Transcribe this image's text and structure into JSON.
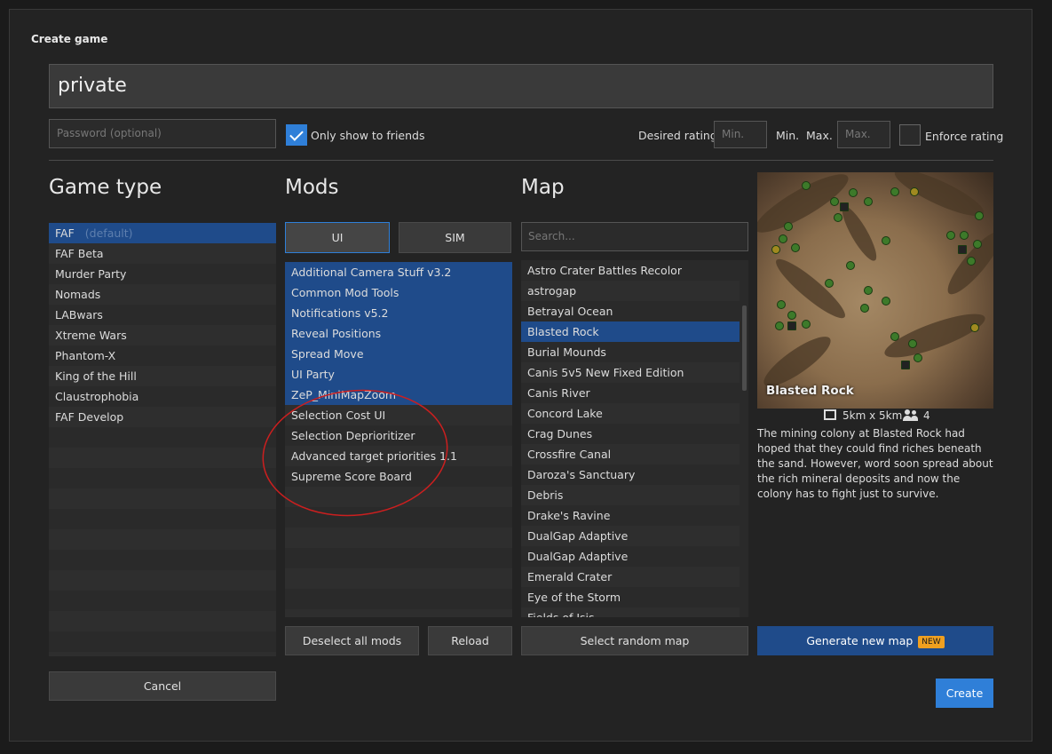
{
  "dialog": {
    "title": "Create game"
  },
  "game_name": {
    "value": "private"
  },
  "password": {
    "placeholder": "Password (optional)"
  },
  "friends_only": {
    "label": "Only show to friends",
    "checked": true
  },
  "rating": {
    "desired_label": "Desired rating",
    "min_placeholder": "Min.",
    "min_label": "Min.",
    "max_label": "Max.",
    "max_placeholder": "Max.",
    "enforce_label": "Enforce rating",
    "enforce_checked": false
  },
  "game_type": {
    "heading": "Game type",
    "items": [
      {
        "label": "FAF",
        "note": "(default)",
        "selected": true
      },
      {
        "label": "FAF Beta"
      },
      {
        "label": "Murder Party"
      },
      {
        "label": "Nomads"
      },
      {
        "label": "LABwars"
      },
      {
        "label": "Xtreme Wars"
      },
      {
        "label": "Phantom-X"
      },
      {
        "label": "King of the Hill"
      },
      {
        "label": "Claustrophobia"
      },
      {
        "label": "FAF Develop"
      }
    ]
  },
  "mods": {
    "heading": "Mods",
    "tab_ui": "UI",
    "tab_sim": "SIM",
    "items": [
      {
        "label": "Additional Camera Stuff v3.2",
        "selected": true
      },
      {
        "label": "Common Mod Tools",
        "selected": true
      },
      {
        "label": "Notifications v5.2",
        "selected": true
      },
      {
        "label": "Reveal Positions",
        "selected": true
      },
      {
        "label": "Spread Move",
        "selected": true
      },
      {
        "label": "UI Party",
        "selected": true
      },
      {
        "label": "ZeP_MiniMapZoom",
        "selected": true
      },
      {
        "label": "Selection Cost UI"
      },
      {
        "label": "Selection Deprioritizer"
      },
      {
        "label": "Advanced target priorities 1.1"
      },
      {
        "label": "Supreme Score Board"
      }
    ],
    "deselect_label": "Deselect all mods",
    "reload_label": "Reload"
  },
  "map": {
    "heading": "Map",
    "search_placeholder": "Search...",
    "items": [
      {
        "label": "Astro Crater Battles Recolor"
      },
      {
        "label": "astrogap"
      },
      {
        "label": "Betrayal Ocean"
      },
      {
        "label": "Blasted Rock",
        "selected": true
      },
      {
        "label": "Burial Mounds"
      },
      {
        "label": "Canis 5v5 New Fixed Edition"
      },
      {
        "label": "Canis River"
      },
      {
        "label": "Concord Lake"
      },
      {
        "label": "Crag Dunes"
      },
      {
        "label": "Crossfire Canal"
      },
      {
        "label": "Daroza's Sanctuary"
      },
      {
        "label": "Debris"
      },
      {
        "label": "Drake's Ravine"
      },
      {
        "label": "DualGap Adaptive"
      },
      {
        "label": "DualGap Adaptive"
      },
      {
        "label": "Emerald Crater"
      },
      {
        "label": "Eye of the Storm"
      },
      {
        "label": "Fields of Isis"
      }
    ],
    "random_label": "Select random map"
  },
  "preview": {
    "name": "Blasted Rock",
    "size": "5km x 5km",
    "players": "4",
    "description": "The mining colony at Blasted Rock had hoped that they could find riches beneath the sand. However, word soon spread about the rich mineral deposits and now the colony has to fight just to survive.",
    "size_icon": "map-size-icon",
    "players_icon": "players-icon"
  },
  "generate": {
    "label": "Generate new map",
    "badge": "NEW"
  },
  "cancel_label": "Cancel",
  "create_label": "Create",
  "colors": {
    "accent": "#2f7fd8",
    "selection": "#1f4b8a",
    "badge": "#f0a020",
    "annotation": "#cc1f1f"
  }
}
